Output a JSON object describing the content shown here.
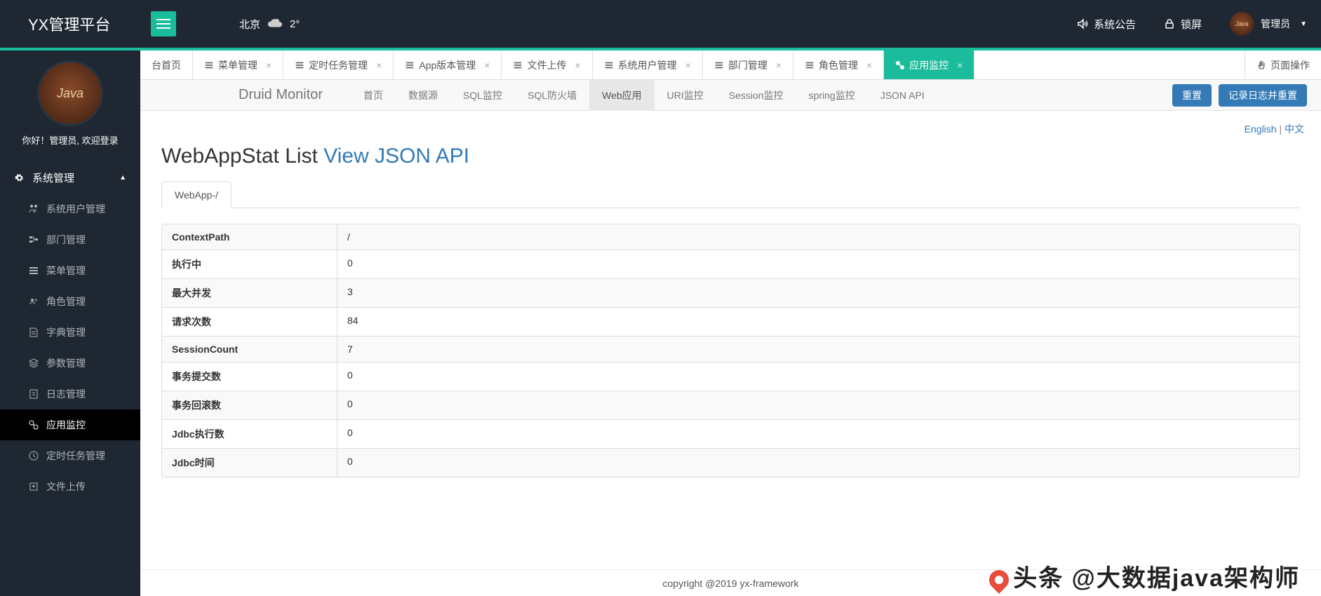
{
  "brand": "YX管理平台",
  "weather": {
    "city": "北京",
    "temp": "2°"
  },
  "toplinks": {
    "announce": "系统公告",
    "lock": "锁屏",
    "user": "管理员"
  },
  "sidebar": {
    "welcome": "你好！管理员, 欢迎登录",
    "header": "系统管理",
    "items": [
      "系统用户管理",
      "部门管理",
      "菜单管理",
      "角色管理",
      "字典管理",
      "参数管理",
      "日志管理",
      "应用监控",
      "定时任务管理",
      "文件上传"
    ]
  },
  "tabs": {
    "first": "台首页",
    "items": [
      "菜单管理",
      "定时任务管理",
      "App版本管理",
      "文件上传",
      "系统用户管理",
      "部门管理",
      "角色管理"
    ],
    "active": "应用监控",
    "end": "页面操作"
  },
  "druid": {
    "brand": "Druid Monitor",
    "links": [
      "首页",
      "数据源",
      "SQL监控",
      "SQL防火墙",
      "Web应用",
      "URI监控",
      "Session监控",
      "spring监控",
      "JSON API"
    ],
    "active_index": 4,
    "btn_reset": "重置",
    "btn_log": "记录日志并重置"
  },
  "lang": {
    "en": "English",
    "zh": "中文"
  },
  "page": {
    "title_prefix": "WebAppStat List ",
    "title_link": "View JSON API"
  },
  "subtab": "WebApp-/",
  "stats": [
    {
      "label": "ContextPath",
      "value": "/"
    },
    {
      "label": "执行中",
      "value": "0"
    },
    {
      "label": "最大并发",
      "value": "3"
    },
    {
      "label": "请求次数",
      "value": "84"
    },
    {
      "label": "SessionCount",
      "value": "7"
    },
    {
      "label": "事务提交数",
      "value": "0"
    },
    {
      "label": "事务回滚数",
      "value": "0"
    },
    {
      "label": "Jdbc执行数",
      "value": "0"
    },
    {
      "label": "Jdbc时间",
      "value": "0"
    }
  ],
  "footer": "copyright @2019 yx-framework",
  "watermark": "头条 @大数据java架构师"
}
